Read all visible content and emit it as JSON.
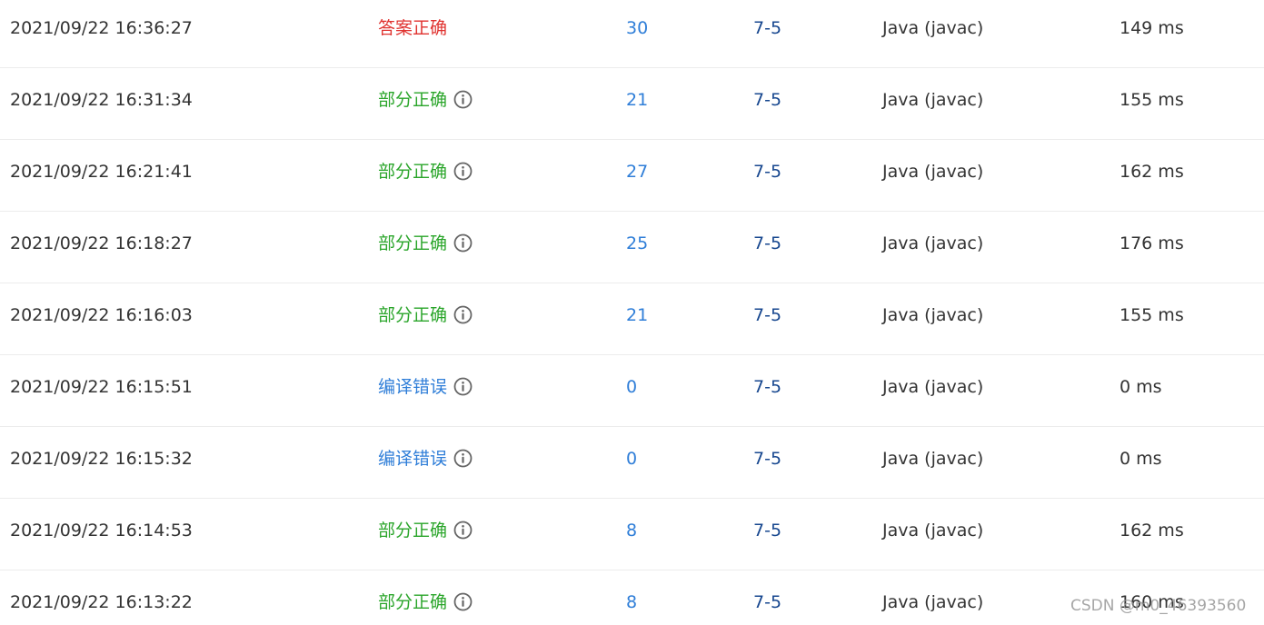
{
  "rows": [
    {
      "time": "2021/09/22 16:36:27",
      "status": "答案正确",
      "status_kind": "ac",
      "has_info": false,
      "score": "30",
      "problem": "7-5",
      "language": "Java (javac)",
      "time_used": "149 ms"
    },
    {
      "time": "2021/09/22 16:31:34",
      "status": "部分正确",
      "status_kind": "partial",
      "has_info": true,
      "score": "21",
      "problem": "7-5",
      "language": "Java (javac)",
      "time_used": "155 ms"
    },
    {
      "time": "2021/09/22 16:21:41",
      "status": "部分正确",
      "status_kind": "partial",
      "has_info": true,
      "score": "27",
      "problem": "7-5",
      "language": "Java (javac)",
      "time_used": "162 ms"
    },
    {
      "time": "2021/09/22 16:18:27",
      "status": "部分正确",
      "status_kind": "partial",
      "has_info": true,
      "score": "25",
      "problem": "7-5",
      "language": "Java (javac)",
      "time_used": "176 ms"
    },
    {
      "time": "2021/09/22 16:16:03",
      "status": "部分正确",
      "status_kind": "partial",
      "has_info": true,
      "score": "21",
      "problem": "7-5",
      "language": "Java (javac)",
      "time_used": "155 ms"
    },
    {
      "time": "2021/09/22 16:15:51",
      "status": "编译错误",
      "status_kind": "ce",
      "has_info": true,
      "score": "0",
      "problem": "7-5",
      "language": "Java (javac)",
      "time_used": "0 ms"
    },
    {
      "time": "2021/09/22 16:15:32",
      "status": "编译错误",
      "status_kind": "ce",
      "has_info": true,
      "score": "0",
      "problem": "7-5",
      "language": "Java (javac)",
      "time_used": "0 ms"
    },
    {
      "time": "2021/09/22 16:14:53",
      "status": "部分正确",
      "status_kind": "partial",
      "has_info": true,
      "score": "8",
      "problem": "7-5",
      "language": "Java (javac)",
      "time_used": "162 ms"
    },
    {
      "time": "2021/09/22 16:13:22",
      "status": "部分正确",
      "status_kind": "partial",
      "has_info": true,
      "score": "8",
      "problem": "7-5",
      "language": "Java (javac)",
      "time_used": "160 ms"
    }
  ],
  "info_icon": "info-circle-icon",
  "colors": {
    "ac": "#e0322f",
    "partial": "#2aa52a",
    "ce": "#2f7ed8",
    "score": "#2f7ed8",
    "problem": "#17478f",
    "icon": "#666666"
  },
  "watermark": "CSDN @m0_46393560"
}
